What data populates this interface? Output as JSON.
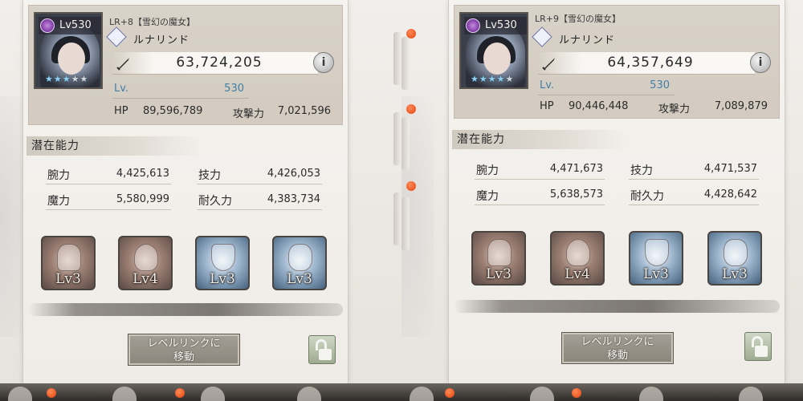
{
  "screens": [
    {
      "level_badge": "Lv530",
      "rarity_label": "LR+8【雪幻の魔女】",
      "character_name": "ルナリンド",
      "stars_filled": 3,
      "stars_total": 5,
      "combat_power": "63,724,205",
      "info_label": "i",
      "level_label": "Lv.",
      "level_value": "530",
      "hp_label": "HP",
      "hp_value": "89,596,789",
      "atk_label": "攻撃力",
      "atk_value": "7,021,596",
      "section_title": "潜在能力",
      "attributes": [
        {
          "label": "腕力",
          "value": "4,425,613"
        },
        {
          "label": "技力",
          "value": "4,426,053"
        },
        {
          "label": "魔力",
          "value": "5,580,999"
        },
        {
          "label": "耐久力",
          "value": "4,383,734"
        }
      ],
      "skills": [
        {
          "icon": "coffin-icon",
          "level": "Lv3",
          "tone": "brown"
        },
        {
          "icon": "skull-icon",
          "level": "Lv4",
          "tone": "brown"
        },
        {
          "icon": "shield-icon",
          "level": "Lv3",
          "tone": "blue"
        },
        {
          "icon": "ice-crest-icon",
          "level": "Lv3",
          "tone": "blue"
        }
      ],
      "level_link_line1": "レベルリンクに",
      "level_link_line2": "移動",
      "lock_state": "unlocked"
    },
    {
      "level_badge": "Lv530",
      "rarity_label": "LR+9【雪幻の魔女】",
      "character_name": "ルナリンド",
      "stars_filled": 4,
      "stars_total": 5,
      "combat_power": "64,357,649",
      "info_label": "i",
      "level_label": "Lv.",
      "level_value": "530",
      "hp_label": "HP",
      "hp_value": "90,446,448",
      "atk_label": "攻撃力",
      "atk_value": "7,089,879",
      "section_title": "潜在能力",
      "attributes": [
        {
          "label": "腕力",
          "value": "4,471,673"
        },
        {
          "label": "技力",
          "value": "4,471,537"
        },
        {
          "label": "魔力",
          "value": "5,638,573"
        },
        {
          "label": "耐久力",
          "value": "4,428,642"
        }
      ],
      "skills": [
        {
          "icon": "coffin-icon",
          "level": "Lv3",
          "tone": "brown"
        },
        {
          "icon": "skull-icon",
          "level": "Lv4",
          "tone": "brown"
        },
        {
          "icon": "shield-icon",
          "level": "Lv3",
          "tone": "blue"
        },
        {
          "icon": "ice-crest-icon",
          "level": "Lv3",
          "tone": "blue"
        }
      ],
      "level_link_line1": "レベルリンクに",
      "level_link_line2": "移動",
      "lock_state": "unlocked"
    }
  ],
  "colors": {
    "level_text": "#3f7fa8",
    "notification_dot": "#e2420f",
    "element_badge": "#7a3aa0"
  }
}
